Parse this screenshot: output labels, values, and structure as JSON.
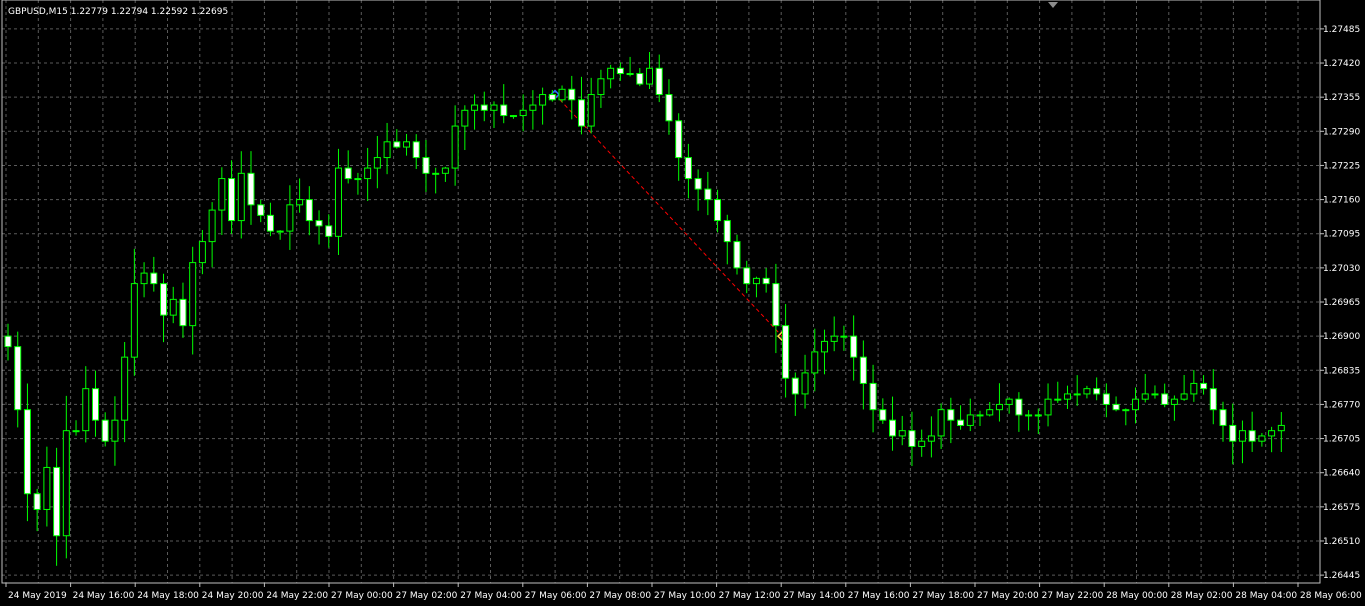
{
  "title": "GBPUSD,M15  1.22779 1.22794 1.22592 1.22695",
  "colors": {
    "background": "#000000",
    "grid": "#5a5a5a",
    "axis": "#bfbfbf",
    "bull_candle": "#000000",
    "bear_candle": "#ffffff",
    "candle_outline": "#00ff00",
    "trade_line": "#ff0000",
    "open_marker": "#2a6cff",
    "close_marker": "#ffd24a"
  },
  "chart_data": {
    "type": "candlestick",
    "symbol": "GBPUSD",
    "timeframe": "M15",
    "ylim": [
      1.2643,
      1.2754
    ],
    "yticks": [
      "1.27485",
      "1.27420",
      "1.27355",
      "1.27290",
      "1.27225",
      "1.27160",
      "1.27095",
      "1.27030",
      "1.26965",
      "1.26900",
      "1.26835",
      "1.26770",
      "1.26705",
      "1.26640",
      "1.26575",
      "1.26510",
      "1.26445"
    ],
    "xticks": [
      "24 May 2019",
      "24 May 16:00",
      "24 May 18:00",
      "24 May 20:00",
      "24 May 22:00",
      "27 May 00:00",
      "27 May 02:00",
      "27 May 04:00",
      "27 May 06:00",
      "27 May 08:00",
      "27 May 10:00",
      "27 May 12:00",
      "27 May 14:00",
      "27 May 16:00",
      "27 May 18:00",
      "27 May 20:00",
      "27 May 22:00",
      "28 May 00:00",
      "28 May 02:00",
      "28 May 04:00",
      "28 May 06:00"
    ],
    "close_path": [
      1.269,
      1.2688,
      1.2676,
      1.266,
      1.2657,
      1.2665,
      1.2652,
      1.2672,
      1.2672,
      1.268,
      1.2674,
      1.267,
      1.2674,
      1.2686,
      1.27,
      1.2702,
      1.27,
      1.2694,
      1.2697,
      1.2692,
      1.2704,
      1.2708,
      1.2714,
      1.272,
      1.2712,
      1.2721,
      1.2715,
      1.2713,
      1.271,
      1.271,
      1.2715,
      1.2716,
      1.2712,
      1.2711,
      1.2709,
      1.2722,
      1.272,
      1.272,
      1.2722,
      1.2724,
      1.2727,
      1.2726,
      1.2727,
      1.2724,
      1.2721,
      1.2721,
      1.2722,
      1.273,
      1.2733,
      1.2734,
      1.2733,
      1.2734,
      1.2732,
      1.2732,
      1.2733,
      1.2734,
      1.2736,
      1.2735,
      1.2737,
      1.2735,
      1.273,
      1.2736,
      1.2739,
      1.2741,
      1.274,
      1.274,
      1.2738,
      1.2741,
      1.2736,
      1.2731,
      1.2724,
      1.272,
      1.2718,
      1.2716,
      1.2712,
      1.2708,
      1.2703,
      1.27,
      1.2701,
      1.27,
      1.2692,
      1.2682,
      1.2679,
      1.2683,
      1.2687,
      1.2689,
      1.269,
      1.269,
      1.2686,
      1.2681,
      1.2676,
      1.2674,
      1.2671,
      1.2672,
      1.2669,
      1.267,
      1.2671,
      1.2676,
      1.2674,
      1.2673,
      1.2675,
      1.2675,
      1.2676,
      1.2677,
      1.2678,
      1.2675,
      1.2675,
      1.2675,
      1.2678,
      1.2678,
      1.2679,
      1.2679,
      1.268,
      1.2679,
      1.2677,
      1.2676,
      1.2676,
      1.2678,
      1.2679,
      1.2679,
      1.2677,
      1.2678,
      1.2679,
      1.2681,
      1.268,
      1.2676,
      1.2673,
      1.267,
      1.2672,
      1.267,
      1.2671,
      1.2672,
      1.2673
    ]
  }
}
